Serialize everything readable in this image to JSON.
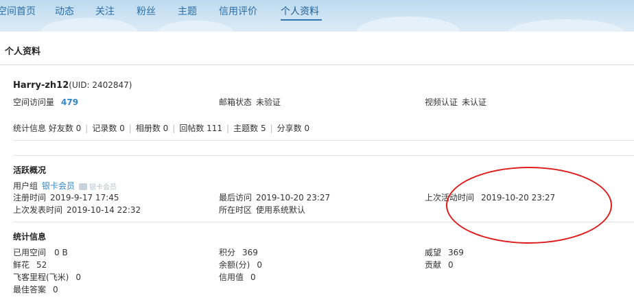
{
  "nav": {
    "items": [
      "空间首页",
      "动态",
      "关注",
      "粉丝",
      "主题",
      "信用评价",
      "个人资料"
    ],
    "active_index": 6
  },
  "page_title": "个人资料",
  "profile": {
    "username": "Harry-zh12",
    "uid": "(UID: 2402847)",
    "visits_label": "空间访问量",
    "visits_value": "479",
    "email_label": "邮箱状态",
    "email_value": "未验证",
    "video_label": "视频认证",
    "video_value": "未认证"
  },
  "stats_line": {
    "label": "统计信息",
    "items": [
      "好友数 0",
      "记录数 0",
      "相册数 0",
      "回帖数 111",
      "主题数 5",
      "分享数 0"
    ]
  },
  "activity": {
    "title": "活跃概况",
    "group_label": "用户组",
    "group_value": "银卡会员",
    "group_badge_text": "银卡会员",
    "reg_label": "注册时间",
    "reg_value": "2019-9-17 17:45",
    "last_visit_label": "最后访问",
    "last_visit_value": "2019-10-20 23:27",
    "last_active_label": "上次活动时间",
    "last_active_value": "2019-10-20 23:27",
    "last_post_label": "上次发表时间",
    "last_post_value": "2019-10-14 22:32",
    "timezone_label": "所在时区",
    "timezone_value": "使用系统默认"
  },
  "statistics": {
    "title": "统计信息",
    "used_space_label": "已用空间",
    "used_space_value": "0 B",
    "points_label": "积分",
    "points_value": "369",
    "prestige_label": "威望",
    "prestige_value": "369",
    "flowers_label": "鲜花",
    "flowers_value": "52",
    "balance_label": "余额(分)",
    "balance_value": "0",
    "contribution_label": "贡献",
    "contribution_value": "0",
    "miles_label": "飞客里程(飞米)",
    "miles_value": "0",
    "credit_label": "信用值",
    "credit_value": "0",
    "best_answer_label": "最佳答案",
    "best_answer_value": "0"
  },
  "colors": {
    "link": "#2f87c8",
    "annotation": "#e01b1b"
  }
}
